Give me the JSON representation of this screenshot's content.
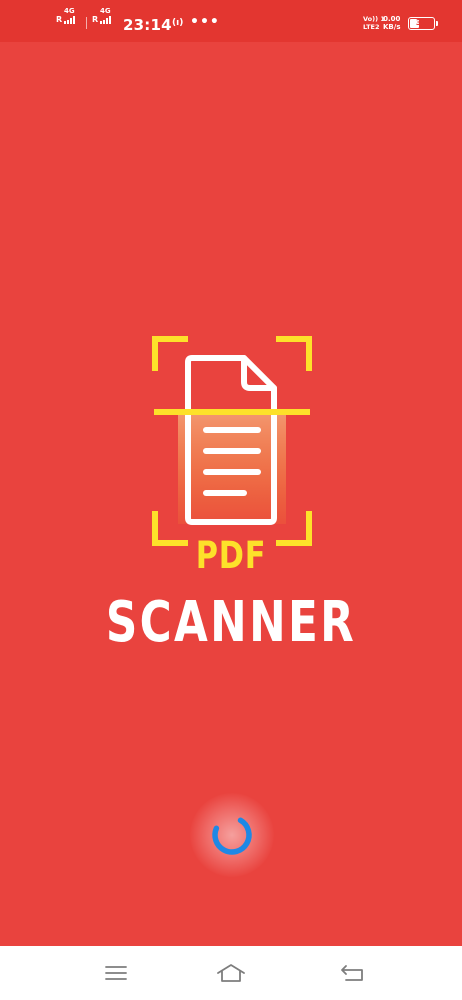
{
  "status_bar": {
    "sim1": {
      "network": "4G",
      "roaming": "R"
    },
    "sim2": {
      "network": "4G",
      "roaming": "R"
    },
    "time": "23:14",
    "hotspot_text": "(ı)",
    "more": "•••",
    "volte_line1": "Vo)) 1",
    "volte_line2": "LTE2",
    "speed_value": "0.00",
    "speed_unit": "KB/s",
    "battery": "39",
    "battery_level": 0.39
  },
  "splash": {
    "logo_word_top": "PDF",
    "logo_word_bottom": "SCANNER"
  },
  "colors": {
    "background": "#e9433e",
    "status_bar": "#e33630",
    "frame_yellow": "#fde12a",
    "spinner_blue": "#1e88e5"
  },
  "nav": {
    "icons": [
      "menu-icon",
      "home-icon",
      "back-icon"
    ]
  }
}
